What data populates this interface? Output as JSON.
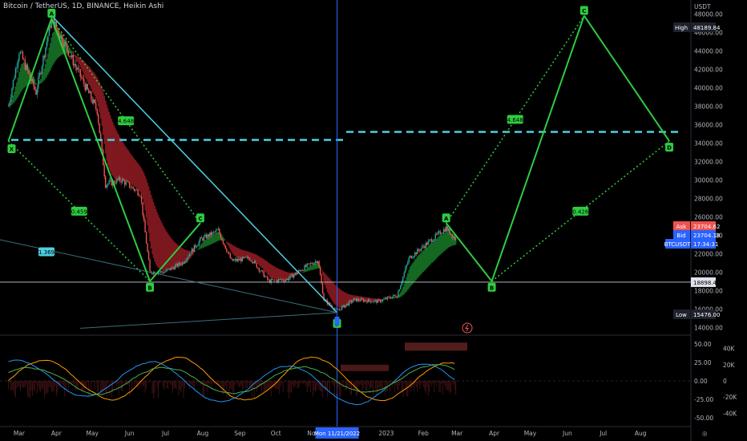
{
  "header": {
    "title": "Bitcoin / TetherUS, 1D, BINANCE, Heikin Ashi"
  },
  "price_axis": {
    "currency": "USDT",
    "ticks": [
      "48000.00",
      "46000.00",
      "44000.00",
      "42000.00",
      "40000.00",
      "38000.00",
      "36000.00",
      "34000.00",
      "32000.00",
      "30000.00",
      "28000.00",
      "26000.00",
      "24000.00",
      "22000.00",
      "20000.00",
      "18000.00",
      "16000.00",
      "14000.00"
    ]
  },
  "price_labels": {
    "high_label": "High",
    "high_value": "48189.84",
    "ask_label": "Ask",
    "ask_value": "23704.62",
    "bid_label": "Bid",
    "bid_value": "23704.18",
    "symbol_label": "BTCUSDT",
    "countdown": "17:34:31",
    "hline_value": "18898.46",
    "low_label": "Low",
    "low_value": "15476.00"
  },
  "time_axis": {
    "ticks": [
      "Mar",
      "Apr",
      "May",
      "Jun",
      "Jul",
      "Aug",
      "Sep",
      "Oct",
      "Nov",
      "2023",
      "Feb",
      "Mar",
      "Apr",
      "May",
      "Jun",
      "Jul",
      "Aug"
    ],
    "crosshair_date": "Mon 11/21/2022"
  },
  "osc_axis": {
    "left_ticks": [
      "50.00",
      "25.00",
      "0.00",
      "-25.00",
      "-50.00"
    ],
    "right_ticks": [
      "40K",
      "20K",
      "0",
      "-20K",
      "-40K"
    ]
  },
  "pattern_labels": {
    "X": "X",
    "A": "A",
    "B": "B",
    "C": "C",
    "D": "D",
    "XB_ratio": "0.459",
    "AC_ratio": "4.648",
    "XD_ratio": "1.369",
    "proj_A": "A",
    "proj_B": "B",
    "proj_C": "C",
    "proj_D": "D",
    "proj_AC_ratio": "4.648",
    "proj_BD_ratio": "0.426"
  },
  "colors": {
    "bg": "#000000",
    "bull": "#26a69a",
    "bear": "#ef5350",
    "pattern_green": "#2ecc40",
    "cyan": "#4dd0e1",
    "crosshair_blue": "#2962ff"
  },
  "chart_data": {
    "type": "line",
    "title": "Bitcoin / TetherUS, 1D, BINANCE, Heikin Ashi",
    "xlabel": "",
    "ylabel": "USDT",
    "ylim": [
      13500,
      49500
    ],
    "series": [
      {
        "values": [
          [
            "2022-02-20",
            38000
          ],
          [
            "2022-03-01",
            44000
          ],
          [
            "2022-03-15",
            39500
          ],
          [
            "2022-03-28",
            47500
          ],
          [
            "2022-04-05",
            45500
          ],
          [
            "2022-04-20",
            41500
          ],
          [
            "2022-05-05",
            37500
          ],
          [
            "2022-05-12",
            29500
          ],
          [
            "2022-05-25",
            30000
          ],
          [
            "2022-06-10",
            28500
          ],
          [
            "2022-06-18",
            20000
          ],
          [
            "2022-06-30",
            20000
          ],
          [
            "2022-07-15",
            21000
          ],
          [
            "2022-07-30",
            23500
          ],
          [
            "2022-08-14",
            24500
          ],
          [
            "2022-08-25",
            21200
          ],
          [
            "2022-09-10",
            21500
          ],
          [
            "2022-09-25",
            19000
          ],
          [
            "2022-10-10",
            19200
          ],
          [
            "2022-10-25",
            20500
          ],
          [
            "2022-11-05",
            21300
          ],
          [
            "2022-11-10",
            17000
          ],
          [
            "2022-11-21",
            15800
          ],
          [
            "2022-12-05",
            17000
          ],
          [
            "2022-12-25",
            16800
          ],
          [
            "2023-01-10",
            17500
          ],
          [
            "2023-01-20",
            21500
          ],
          [
            "2023-02-05",
            23200
          ],
          [
            "2023-02-20",
            24800
          ],
          [
            "2023-02-28",
            23500
          ]
        ]
      }
    ],
    "pattern_points": [
      [
        "X",
        "2022-02-20",
        34200
      ],
      [
        "A",
        "2022-03-28",
        47500
      ],
      [
        "B",
        "2022-06-18",
        19000
      ],
      [
        "C",
        "2022-07-30",
        25300
      ],
      [
        "D",
        "2022-11-21",
        15600
      ]
    ],
    "projected_points": [
      [
        "A",
        "2023-02-20",
        25300
      ],
      [
        "B",
        "2023-03-30",
        19000
      ],
      [
        "C",
        "2023-06-15",
        47800
      ],
      [
        "D",
        "2023-08-25",
        34200
      ]
    ],
    "horizontal_levels": [
      34500,
      18898.46
    ],
    "oscillator": {
      "ylim": [
        -60,
        60
      ],
      "ticks": [
        50,
        25,
        0,
        -25,
        -50
      ]
    }
  }
}
